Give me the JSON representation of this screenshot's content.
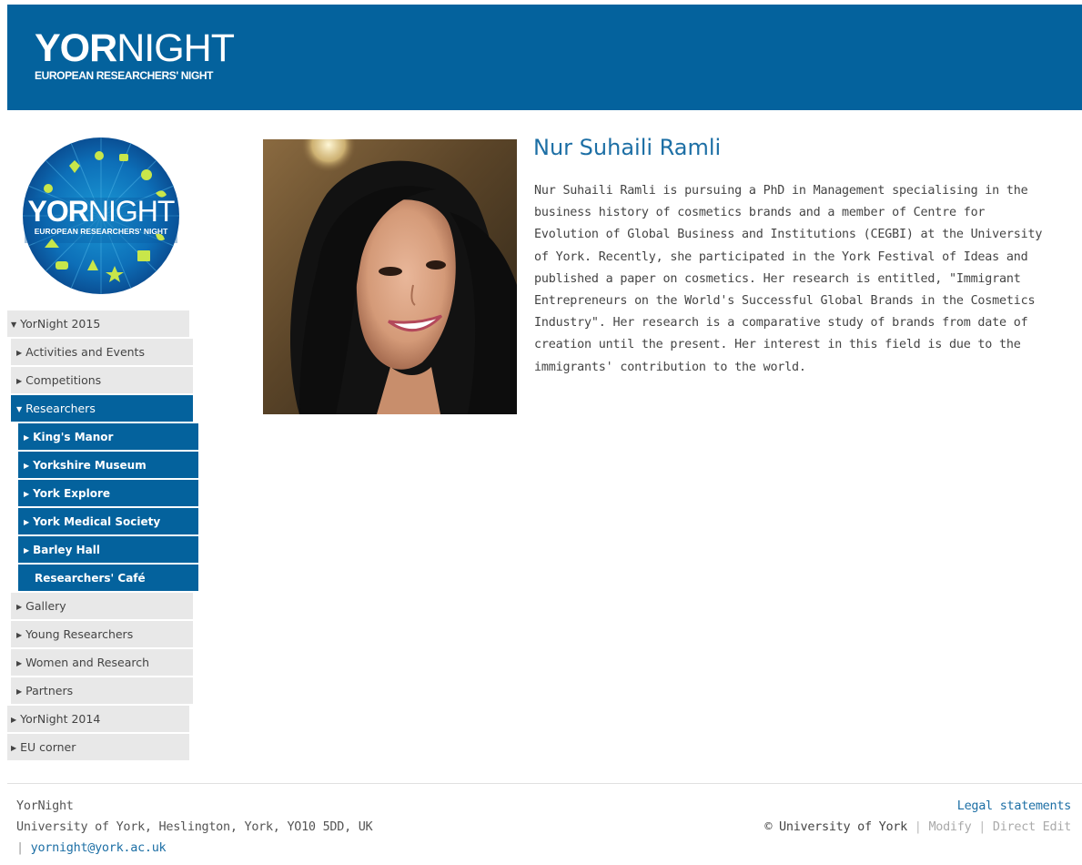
{
  "header": {
    "logo_bold": "YOR",
    "logo_light": "NIGHT",
    "logo_subtitle": "EUROPEAN RESEARCHERS' NIGHT"
  },
  "sidebar": {
    "badge_text_bold": "YOR",
    "badge_text_light": "NIGHT",
    "badge_subtitle": "EUROPEAN RESEARCHERS' NIGHT",
    "items": [
      {
        "label": "YorNight 2015",
        "state": "expanded"
      },
      {
        "label": "Activities and Events",
        "state": "collapsed"
      },
      {
        "label": "Competitions",
        "state": "collapsed"
      },
      {
        "label": "Researchers",
        "state": "expanded-active"
      },
      {
        "label": "King's Manor",
        "state": "collapsed"
      },
      {
        "label": "Yorkshire Museum",
        "state": "collapsed"
      },
      {
        "label": "York Explore",
        "state": "collapsed"
      },
      {
        "label": "York Medical Society",
        "state": "collapsed"
      },
      {
        "label": "Barley Hall",
        "state": "collapsed"
      },
      {
        "label": "Researchers' Café",
        "state": "leaf"
      },
      {
        "label": "Gallery",
        "state": "collapsed"
      },
      {
        "label": "Young Researchers",
        "state": "collapsed"
      },
      {
        "label": "Women and Research",
        "state": "collapsed"
      },
      {
        "label": "Partners",
        "state": "collapsed"
      },
      {
        "label": "YorNight 2014",
        "state": "collapsed"
      },
      {
        "label": "EU corner",
        "state": "collapsed"
      }
    ]
  },
  "main": {
    "name": "Nur Suhaili Ramli",
    "bio": "Nur Suhaili Ramli is pursuing a PhD in Management specialising in the business history of cosmetics brands and a member of Centre for Evolution of Global Business and Institutions (CEGBI) at the University of York. Recently, she participated in the York Festival of Ideas and published a paper on cosmetics. Her research is entitled, \"Immigrant Entrepreneurs on the World's Successful Global Brands in the Cosmetics Industry\". Her research is a comparative study of brands from date of creation until the present. Her interest in this field is due to the immigrants' contribution to the world."
  },
  "footer": {
    "org": "YorNight",
    "address": "University of York, Heslington, York, YO10 5DD, UK",
    "separator": "|",
    "email": "yornight@york.ac.uk",
    "legal": "Legal statements",
    "copyright": "© University of York",
    "modify": "Modify",
    "direct_edit": "Direct Edit"
  },
  "colors": {
    "brand_blue": "#04629d",
    "nav_grey": "#e8e8e8",
    "link_blue": "#1d6fa5"
  }
}
